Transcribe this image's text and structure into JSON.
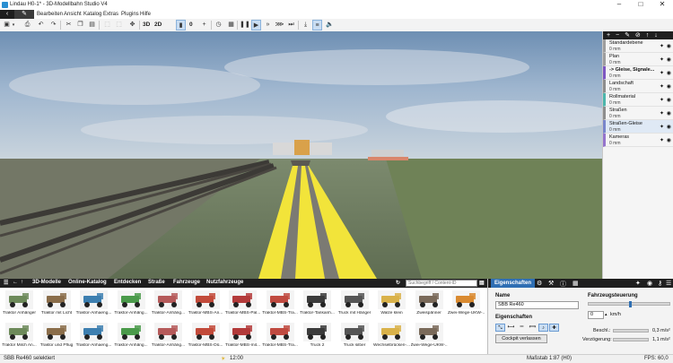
{
  "window": {
    "title": "Lindau H0-1* - 3D-Modellbahn Studio V4",
    "controls": [
      "–",
      "□",
      "✕"
    ]
  },
  "menu": [
    "Bearbeiten",
    "Ansicht",
    "Katalog",
    "Extras",
    "Plugins",
    "Hilfe"
  ],
  "toolbar": {
    "btn_3d": "3D",
    "btn_2d": "2D",
    "zero": "0"
  },
  "layers": [
    {
      "name": "Standardebene",
      "height": "0 mm",
      "color": "#9e9e9e",
      "selected": false
    },
    {
      "name": "Plan",
      "height": "0 mm",
      "color": "#9e9e9e",
      "selected": false
    },
    {
      "name": "-> Gleise, Signale...",
      "height": "0 mm",
      "color": "#7e57c2",
      "selected": false,
      "bold": true
    },
    {
      "name": "Landschaft",
      "height": "0 mm",
      "color": "#8e8e8e",
      "selected": false
    },
    {
      "name": "Rollmaterial",
      "height": "0 mm",
      "color": "#4db6ac",
      "selected": false
    },
    {
      "name": "Straßen",
      "height": "0 mm",
      "color": "#8e8e8e",
      "selected": false
    },
    {
      "name": "Straßen-Gleise",
      "height": "0 mm",
      "color": "#7986cb",
      "selected": true
    },
    {
      "name": "Kameras",
      "height": "0 mm",
      "color": "#9575cd",
      "selected": false
    }
  ],
  "catalog": {
    "breadcrumb": [
      "3D-Modelle",
      "Online-Katalog",
      "Entdecken",
      "Straße",
      "Fahrzeuge",
      "Nutzfahrzeuge"
    ],
    "search_placeholder": "Suchbegriff / Content-ID",
    "row1": [
      "Traktor Anhänger",
      "Traktor mit Licht",
      "Traktor-Anhaeng...",
      "Traktor-Anhäng...",
      "Traktor-Anhäng...",
      "Traktor-MBS-An...",
      "Traktor-MBS-Pal...",
      "Traktor-MBS-Tra...",
      "Traktor-Tankanh...",
      "Truck mit Hänger",
      "Walze klein",
      "Zweispänner",
      "Zwei-Wege-UKW-..."
    ],
    "row2": [
      "Traktor Milch An...",
      "Traktor und Pflug",
      "Traktor-Anhaeng...",
      "Traktor-Anhäng...",
      "Traktor-Anhäng...",
      "Traktor-MBS-Dü...",
      "Traktor-MBS-mit...",
      "Traktor-MBS-Tra...",
      "Truck 2",
      "Truck silber",
      "Wechselbrücken-...",
      "Zwei-Wege-UKW-..."
    ]
  },
  "properties": {
    "tab": "Eigenschaften",
    "name_label": "Name",
    "name_value": "SBB Re460",
    "section_label": "Eigenschaften",
    "cockpit_button": "Cockpit verlassen",
    "speed_label": "Fahrzeugsteuerung",
    "speed_value": "0",
    "speed_unit": "km/h",
    "accel_label": "Beschl.:",
    "accel_value": "0,3 m/s²",
    "decel_label": "Verzögerung:",
    "decel_value": "1,1 m/s²"
  },
  "status": {
    "selection": "SBB Re460 selektiert",
    "time": "12:00",
    "scale": "Maßstab 1:87 (H0)",
    "fps": "FPS: 60,0"
  }
}
